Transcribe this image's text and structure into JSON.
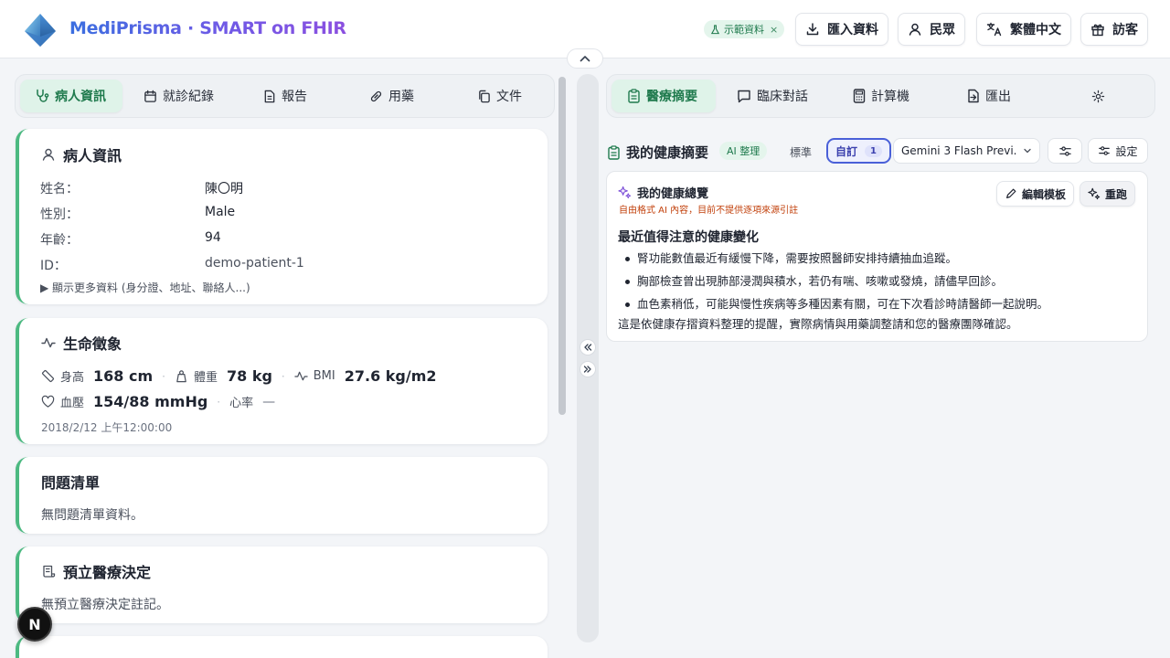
{
  "header": {
    "app_title": "MediPrisma · SMART on FHIR",
    "demo_badge": "示範資料",
    "demo_badge_close": "×",
    "buttons": {
      "import": "匯入資料",
      "persona": "民眾",
      "language": "繁體中文",
      "guest": "訪客"
    }
  },
  "left_tabs": [
    {
      "label": "病人資訊",
      "icon": "stethoscope-icon",
      "active": true
    },
    {
      "label": "就診紀錄",
      "icon": "calendar-icon",
      "active": false
    },
    {
      "label": "報告",
      "icon": "file-text-icon",
      "active": false
    },
    {
      "label": "用藥",
      "icon": "pill-icon",
      "active": false
    },
    {
      "label": "文件",
      "icon": "copy-icon",
      "active": false
    }
  ],
  "patient_card": {
    "title": "病人資訊",
    "fields": [
      {
        "label": "姓名：",
        "value": "陳〇明"
      },
      {
        "label": "性別：",
        "value": "Male"
      },
      {
        "label": "年齡：",
        "value": "94"
      },
      {
        "label": "ID：",
        "value": "demo-patient-1"
      }
    ],
    "more": "▶ 顯示更多資料 (身分證、地址、聯絡人...)"
  },
  "vitals_card": {
    "title": "生命徵象",
    "height_label": "身高",
    "height_value": "168 cm",
    "weight_label": "體重",
    "weight_value": "78 kg",
    "bmi_label": "BMI",
    "bmi_value": "27.6 kg/m2",
    "bp_label": "血壓",
    "bp_value": "154/88 mmHg",
    "hr_label": "心率",
    "hr_value": "—",
    "separator": "·",
    "timestamp": "2018/2/12 上午12:00:00"
  },
  "problems_card": {
    "title": "問題清單",
    "empty": "無問題清單資料。"
  },
  "advance_card": {
    "title": "預立醫療決定",
    "empty": "無預立醫療決定註記。"
  },
  "right_tabs": [
    {
      "label": "醫療摘要",
      "icon": "clipboard-icon",
      "active": true
    },
    {
      "label": "臨床對話",
      "icon": "chat-icon",
      "active": false
    },
    {
      "label": "計算機",
      "icon": "calculator-icon",
      "active": false
    },
    {
      "label": "匯出",
      "icon": "export-icon",
      "active": false
    }
  ],
  "summary_header": {
    "title": "我的健康摘要",
    "ai_badge": "AI 整理",
    "standard": "標準",
    "custom": "自訂",
    "custom_count": "1",
    "model": "Gemini 3 Flash Previ...",
    "settings": "設定"
  },
  "summary_card": {
    "title": "我的健康總覽",
    "subtitle": "自由格式 AI 內容，目前不提供逐項來源引註",
    "edit_template": "編輯模板",
    "rerun": "重跑",
    "heading": "最近值得注意的健康變化",
    "bullets": [
      "腎功能數值最近有緩慢下降，需要按照醫師安排持續抽血追蹤。",
      "胸部檢查曾出現肺部浸潤與積水，若仍有喘、咳嗽或發燒，請儘早回診。",
      "血色素稍低，可能與慢性疾病等多種因素有關，可在下次看診時請醫師一起說明。"
    ],
    "footer": "這是依健康存摺資料整理的提醒，實際病情與用藥調整請和您的醫療團隊確認。"
  },
  "dev_badge": "N",
  "colors": {
    "accent_green": "#4cb981",
    "active_tab_bg": "#dff3e9",
    "active_tab_text": "#1f7a4d",
    "custom_border": "#4a60d8",
    "warning_text": "#c2410c"
  }
}
